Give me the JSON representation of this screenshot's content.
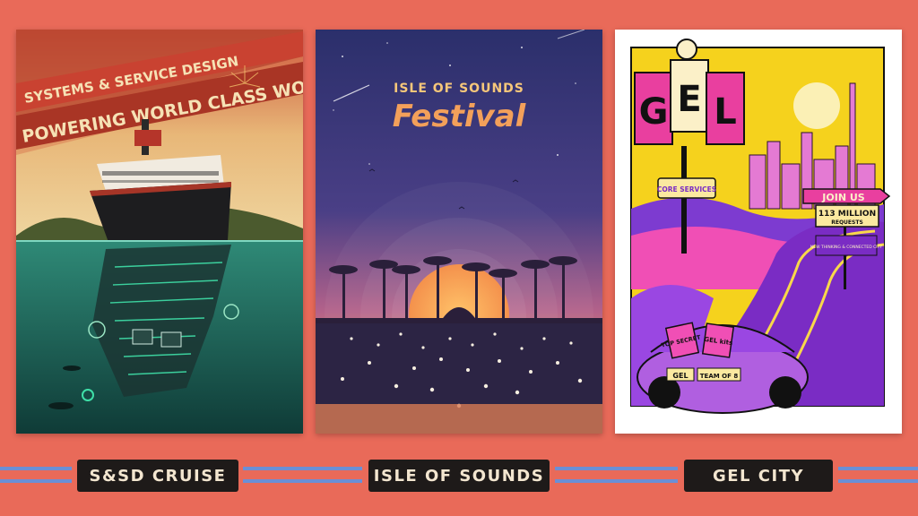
{
  "posters": [
    {
      "id": "sd-cruise",
      "headline_top": "SYSTEMS & SERVICE DESIGN",
      "headline_main": "POWERING WORLD CLASS WORK",
      "caption": "S&SD CRUISE"
    },
    {
      "id": "isle-of-sounds",
      "headline_top": "ISLE OF SOUNDS",
      "headline_main": "Festival",
      "caption": "ISLE OF SOUNDS"
    },
    {
      "id": "gel-city",
      "logo_letters": [
        "G",
        "E",
        "L"
      ],
      "sign_core": "CORE SERVICES",
      "sign_join": "JOIN US",
      "sign_count": "113 MILLION",
      "sign_requests": "REQUESTS",
      "sign_small": "NEW THINKING & CONNECTED CITY",
      "box_1": "TOP SECRET",
      "box_2": "GEL kits",
      "plate_1": "GEL",
      "plate_2": "TEAM OF 8",
      "caption": "GEL CITY"
    }
  ],
  "colors": {
    "background": "#e96a59",
    "stripe": "#6b8fd6",
    "label_bg": "#1e1a19",
    "label_text": "#f3e6d0"
  }
}
